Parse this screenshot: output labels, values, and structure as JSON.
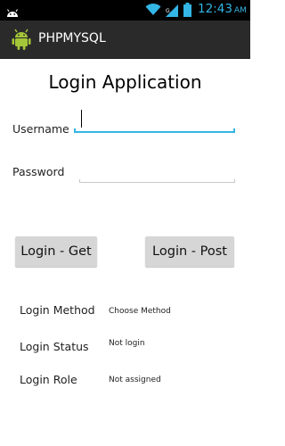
{
  "status_bar": {
    "time": "12:43",
    "ampm": "AM",
    "accent_color": "#33b5e5",
    "icons": [
      "android-notification-icon",
      "wifi-icon",
      "signal-icon",
      "battery-icon"
    ]
  },
  "action_bar": {
    "title": "PHPMYSQL",
    "icon": "android-app-icon",
    "background": "#2a2a2a"
  },
  "form": {
    "title": "Login Application",
    "username_label": "Username",
    "username_value": "",
    "password_label": "Password",
    "password_value": ""
  },
  "buttons": {
    "get_label": "Login - Get",
    "post_label": "Login - Post"
  },
  "info": {
    "method_label": "Login Method",
    "method_value": "Choose Method",
    "status_label": "Login Status",
    "status_value": "Not login",
    "role_label": "Login Role",
    "role_value": "Not assigned"
  }
}
